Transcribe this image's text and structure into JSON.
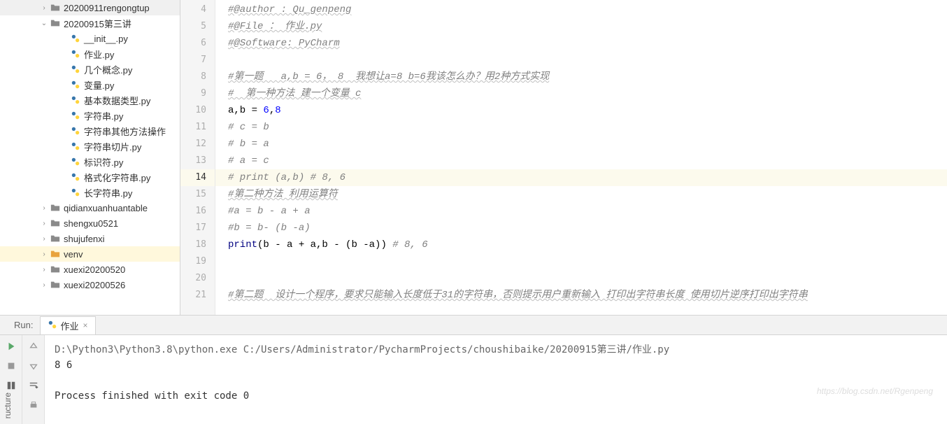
{
  "tree": {
    "items": [
      {
        "type": "folder",
        "label": "20200911rengongtup",
        "indent": 1,
        "arrow": "right",
        "special": false
      },
      {
        "type": "folder",
        "label": "20200915第三讲",
        "indent": 1,
        "arrow": "down",
        "special": false
      },
      {
        "type": "pyfile",
        "label": "__init__.py",
        "indent": 3
      },
      {
        "type": "pyfile",
        "label": "作业.py",
        "indent": 3
      },
      {
        "type": "pyfile",
        "label": "几个概念.py",
        "indent": 3
      },
      {
        "type": "pyfile",
        "label": "变量.py",
        "indent": 3
      },
      {
        "type": "pyfile",
        "label": "基本数据类型.py",
        "indent": 3
      },
      {
        "type": "pyfile",
        "label": "字符串.py",
        "indent": 3
      },
      {
        "type": "pyfile",
        "label": "字符串其他方法操作",
        "indent": 3
      },
      {
        "type": "pyfile",
        "label": "字符串切片.py",
        "indent": 3
      },
      {
        "type": "pyfile",
        "label": "标识符.py",
        "indent": 3
      },
      {
        "type": "pyfile",
        "label": "格式化字符串.py",
        "indent": 3
      },
      {
        "type": "pyfile",
        "label": "长字符串.py",
        "indent": 3
      },
      {
        "type": "folder",
        "label": "qidianxuanhuantable",
        "indent": 1,
        "arrow": "right",
        "special": false
      },
      {
        "type": "folder",
        "label": "shengxu0521",
        "indent": 1,
        "arrow": "right",
        "special": false
      },
      {
        "type": "folder",
        "label": "shujufenxi",
        "indent": 1,
        "arrow": "right",
        "special": false
      },
      {
        "type": "folder",
        "label": "venv",
        "indent": 1,
        "arrow": "right",
        "special": true,
        "selected": true
      },
      {
        "type": "folder",
        "label": "xuexi20200520",
        "indent": 1,
        "arrow": "right",
        "special": false
      },
      {
        "type": "folder",
        "label": "xuexi20200526",
        "indent": 1,
        "arrow": "right",
        "special": false
      }
    ]
  },
  "editor": {
    "currentLine": 14,
    "lines": [
      {
        "num": 4,
        "segs": [
          {
            "cls": "comment-underline",
            "t": "#@author : Qu_genpeng"
          }
        ]
      },
      {
        "num": 5,
        "segs": [
          {
            "cls": "comment-underline",
            "t": "#@File ： 作业.py"
          }
        ]
      },
      {
        "num": 6,
        "segs": [
          {
            "cls": "comment-underline",
            "t": "#@Software: PyCharm"
          }
        ]
      },
      {
        "num": 7,
        "segs": []
      },
      {
        "num": 8,
        "segs": [
          {
            "cls": "comment-underline",
            "t": "#第一题   a,b = 6， 8  我想让a=8 b=6我该怎么办？用2种方式实现"
          }
        ]
      },
      {
        "num": 9,
        "segs": [
          {
            "cls": "comment-underline",
            "t": "#  第一种方法 建一个变量 c"
          }
        ]
      },
      {
        "num": 10,
        "segs": [
          {
            "cls": "plain",
            "t": "a,b = "
          },
          {
            "cls": "number",
            "t": "6"
          },
          {
            "cls": "plain",
            "t": ","
          },
          {
            "cls": "number",
            "t": "8"
          }
        ]
      },
      {
        "num": 11,
        "segs": [
          {
            "cls": "comment",
            "t": "# c = b"
          }
        ]
      },
      {
        "num": 12,
        "segs": [
          {
            "cls": "comment",
            "t": "# b = a"
          }
        ]
      },
      {
        "num": 13,
        "segs": [
          {
            "cls": "comment",
            "t": "# a = c"
          }
        ]
      },
      {
        "num": 14,
        "segs": [
          {
            "cls": "comment",
            "t": "# print (a,b) # 8, 6"
          }
        ]
      },
      {
        "num": 15,
        "segs": [
          {
            "cls": "comment-underline",
            "t": "#第二种方法 利用运算符"
          }
        ]
      },
      {
        "num": 16,
        "segs": [
          {
            "cls": "comment",
            "t": "#a = b - a + a"
          }
        ]
      },
      {
        "num": 17,
        "segs": [
          {
            "cls": "comment",
            "t": "#b = b- (b -a)"
          }
        ]
      },
      {
        "num": 18,
        "segs": [
          {
            "cls": "builtin",
            "t": "print"
          },
          {
            "cls": "plain",
            "t": "(b - a + a,b - (b -a)) "
          },
          {
            "cls": "comment",
            "t": "# 8, 6"
          }
        ]
      },
      {
        "num": 19,
        "segs": []
      },
      {
        "num": 20,
        "segs": []
      },
      {
        "num": 21,
        "segs": [
          {
            "cls": "comment-underline",
            "t": "#第二题  设计一个程序，要求只能输入长度低于31的字符串，否则提示用户重新输入 打印出字符串长度 使用切片逆序打印出字符串"
          }
        ]
      }
    ]
  },
  "run": {
    "label": "Run:",
    "tabName": "作业",
    "output": [
      {
        "cls": "out-path",
        "t": "D:\\Python3\\Python3.8\\python.exe C:/Users/Administrator/PycharmProjects/choushibaike/20200915第三讲/作业.py"
      },
      {
        "cls": "",
        "t": "8 6"
      },
      {
        "cls": "",
        "t": ""
      },
      {
        "cls": "",
        "t": "Process finished with exit code 0"
      }
    ]
  },
  "sideLabel": "ructure",
  "watermark": "https://blog.csdn.net/Rgenpeng"
}
